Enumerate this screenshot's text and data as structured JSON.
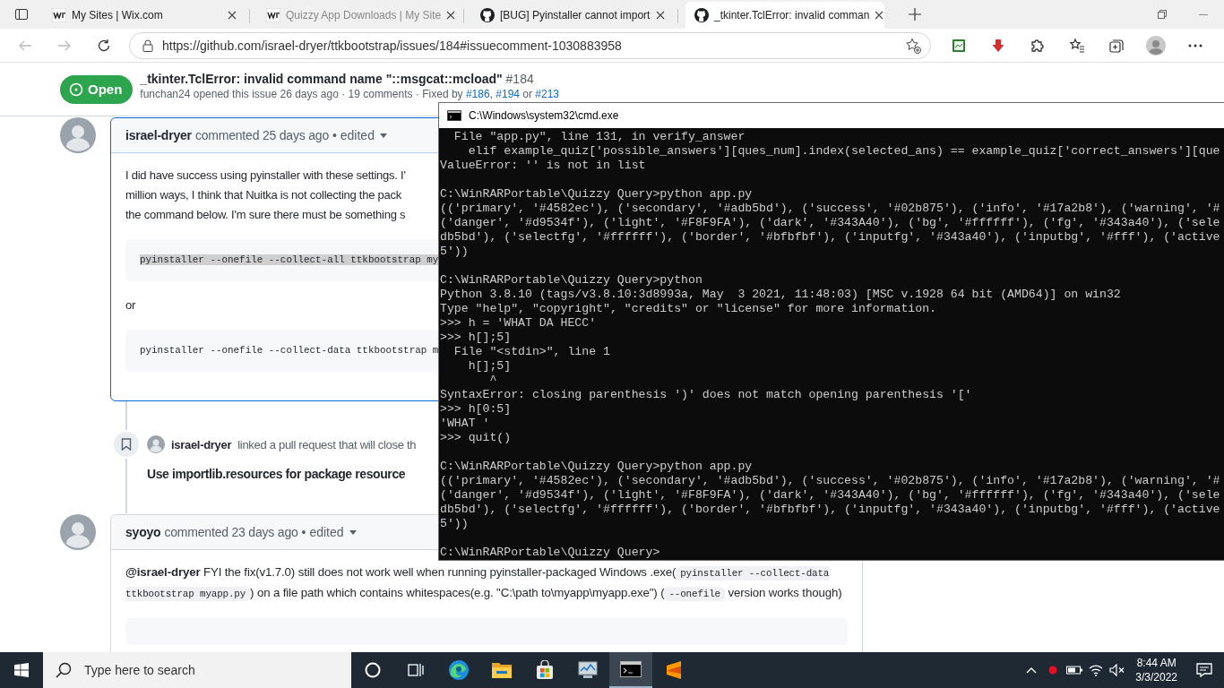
{
  "browser": {
    "tabs": [
      {
        "kind": "wix",
        "label": "My Sites | Wix.com",
        "selected": false,
        "faded": false
      },
      {
        "kind": "wix",
        "label": "Quizzy App Downloads | My Site",
        "selected": false,
        "faded": true
      },
      {
        "kind": "github",
        "label": "[BUG] Pyinstaller cannot import",
        "selected": false,
        "faded": false
      },
      {
        "kind": "github",
        "label": "_tkinter.TclError: invalid comman",
        "selected": true,
        "faded": false
      }
    ],
    "address": "https://github.com/israel-dryer/ttkbootstrap/issues/184#issuecomment-1030883958"
  },
  "issue": {
    "state": "Open",
    "title": "_tkinter.TclError: invalid command name \"::msgcat::mcload\"",
    "number": "#184",
    "meta": [
      {
        "kind": "author",
        "text": "funchan24"
      },
      {
        "kind": "text",
        "text": " opened this issue 26 days ago · 19 comments · Fixed by "
      },
      {
        "kind": "link",
        "text": "#186"
      },
      {
        "kind": "text",
        "text": ", "
      },
      {
        "kind": "link",
        "text": "#194"
      },
      {
        "kind": "text",
        "text": " or "
      },
      {
        "kind": "link",
        "text": "#213"
      }
    ]
  },
  "timeline": [
    {
      "kind": "comment",
      "author": "israel-dryer",
      "action": "commented 25 days ago",
      "edited": "• edited",
      "targeted": true,
      "body": [
        {
          "kind": "lines",
          "lines": [
            "I did have success using pyinstaller with these settings. I'",
            "million ways, I think that Nuitka is not collecting the pack",
            "the command below. I'm sure there must be something s"
          ]
        },
        {
          "kind": "code",
          "text": "pyinstaller --onefile --collect-all ttkbootstrap my",
          "selected": true
        },
        {
          "kind": "lines",
          "lines": [
            "or"
          ]
        },
        {
          "kind": "code",
          "text": "pyinstaller --onefile --collect-data ttkbootstrap m",
          "selected": false
        }
      ]
    },
    {
      "kind": "event",
      "author": "israel-dryer",
      "text": "linked a pull request that will close th",
      "pr_title": "Use importlib.resources for package resource"
    },
    {
      "kind": "comment",
      "author": "syoyo",
      "action": "commented 23 days ago",
      "edited": "• edited",
      "targeted": false,
      "body": [
        {
          "kind": "rich",
          "segments": [
            {
              "kind": "mention",
              "text": "@israel-dryer"
            },
            {
              "kind": "text",
              "text": " FYI the fix(v1.7.0) still does not work well when running pyinstaller-packaged Windows .exe("
            },
            {
              "kind": "code",
              "text": "pyinstaller --collect-data ttkbootstrap myapp.py"
            },
            {
              "kind": "text",
              "text": ") on a file path which contains whitespaces(e.g. \"C:\\path to\\myapp\\myapp.exe\") ("
            },
            {
              "kind": "code",
              "text": "--onefile"
            },
            {
              "kind": "text",
              "text": " version works though)"
            }
          ]
        },
        {
          "kind": "blank-code"
        }
      ]
    }
  ],
  "console": {
    "title": "C:\\Windows\\system32\\cmd.exe",
    "blocks": [
      [
        "  File \"app.py\", line 131, in verify_answer",
        "    elif example_quiz['possible_answers'][ques_num].index(selected_ans) == example_quiz['correct_answers'][que",
        "ValueError: '' is not in list"
      ],
      [
        "C:\\WinRARPortable\\Quizzy Query>python app.py",
        "(('primary', '#4582ec'), ('secondary', '#adb5bd'), ('success', '#02b875'), ('info', '#17a2b8'), ('warning', '#",
        "('danger', '#d9534f'), ('light', '#F8F9FA'), ('dark', '#343A40'), ('bg', '#ffffff'), ('fg', '#343a40'), ('sele",
        "db5bd'), ('selectfg', '#ffffff'), ('border', '#bfbfbf'), ('inputfg', '#343a40'), ('inputbg', '#fff'), ('active",
        "5'))"
      ],
      [
        "C:\\WinRARPortable\\Quizzy Query>python",
        "Python 3.8.10 (tags/v3.8.10:3d8993a, May  3 2021, 11:48:03) [MSC v.1928 64 bit (AMD64)] on win32",
        "Type \"help\", \"copyright\", \"credits\" or \"license\" for more information.",
        ">>> h = 'WHAT DA HECC'",
        ">>> h[];5]",
        "  File \"<stdin>\", line 1",
        "    h[];5]",
        "       ^",
        "SyntaxError: closing parenthesis ')' does not match opening parenthesis '['",
        ">>> h[0:5]",
        "'WHAT '",
        ">>> quit()"
      ],
      [
        "C:\\WinRARPortable\\Quizzy Query>python app.py",
        "(('primary', '#4582ec'), ('secondary', '#adb5bd'), ('success', '#02b875'), ('info', '#17a2b8'), ('warning', '#",
        "('danger', '#d9534f'), ('light', '#F8F9FA'), ('dark', '#343A40'), ('bg', '#ffffff'), ('fg', '#343a40'), ('sele",
        "db5bd'), ('selectfg', '#ffffff'), ('border', '#bfbfbf'), ('inputfg', '#343a40'), ('inputbg', '#fff'), ('active",
        "5'))"
      ],
      [
        "C:\\WinRARPortable\\Quizzy Query>"
      ]
    ]
  },
  "taskbar": {
    "search_placeholder": "Type here to search",
    "apps": [
      {
        "kind": "cortana",
        "active": false
      },
      {
        "kind": "taskview",
        "active": false
      },
      {
        "kind": "edge",
        "active": false
      },
      {
        "kind": "explorer",
        "active": false
      },
      {
        "kind": "store",
        "active": false
      },
      {
        "kind": "monitor",
        "active": false
      },
      {
        "kind": "terminal",
        "active": true
      },
      {
        "kind": "sublime",
        "active": false
      }
    ],
    "time": "8:44 AM",
    "date": "3/3/2022"
  }
}
